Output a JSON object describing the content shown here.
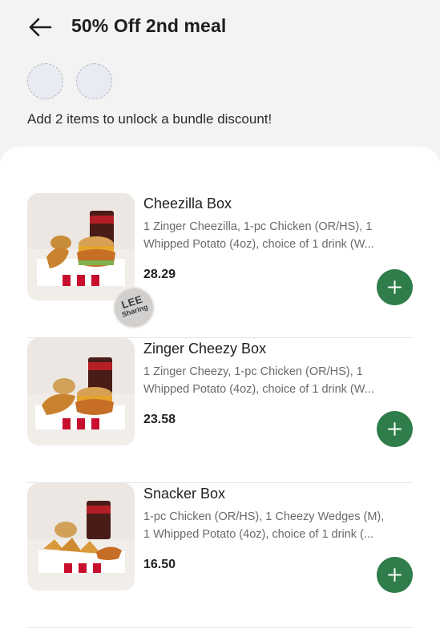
{
  "header": {
    "title": "50% Off 2nd meal",
    "back_icon": "arrow-left-icon"
  },
  "bundle": {
    "slots": 2,
    "hint": "Add 2 items to unlock a bundle discount!"
  },
  "sticker": {
    "line1": "LEE",
    "line2": "Sharing"
  },
  "items": [
    {
      "name": "Cheezilla Box",
      "desc_line1": "1 Zinger Cheezilla, 1-pc Chicken (OR/HS), 1",
      "desc_line2": "Whipped Potato (4oz), choice of 1 drink (W...",
      "price": "28.29"
    },
    {
      "name": "Zinger Cheezy Box",
      "desc_line1": "1 Zinger Cheezy, 1-pc Chicken (OR/HS), 1",
      "desc_line2": "Whipped Potato (4oz), choice of 1 drink (W...",
      "price": "23.58"
    },
    {
      "name": "Snacker Box",
      "desc_line1": "1-pc Chicken (OR/HS), 1 Cheezy Wedges (M),",
      "desc_line2": "1 Whipped Potato (4oz), choice of 1 drink (...",
      "price": "16.50"
    }
  ],
  "colors": {
    "add_button": "#2f7d4a",
    "page_bg": "#f3f3f3",
    "sheet_bg": "#ffffff"
  }
}
